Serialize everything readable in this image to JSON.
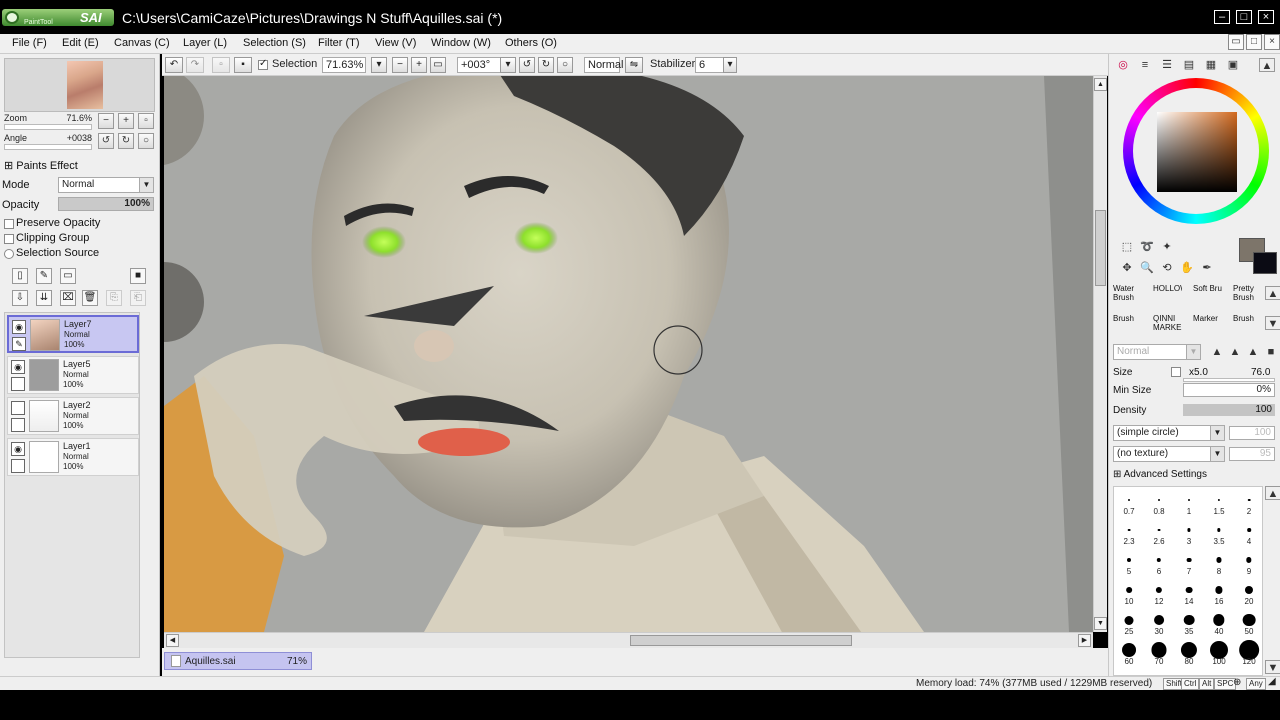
{
  "window": {
    "app_logo_small": "PaintTool",
    "app_logo_big": "SAI",
    "title": "C:\\Users\\CamiCaze\\Pictures\\Drawings N Stuff\\Aquilles.sai (*)"
  },
  "menu": [
    "File (F)",
    "Edit (E)",
    "Canvas (C)",
    "Layer (L)",
    "Selection (S)",
    "Filter (T)",
    "View (V)",
    "Window (W)",
    "Others (O)"
  ],
  "navigator": {
    "zoom_label": "Zoom",
    "zoom_value": "71.6%",
    "angle_label": "Angle",
    "angle_value": "+0038"
  },
  "layer_props": {
    "paints_effect": "Paints Effect",
    "mode_label": "Mode",
    "mode_value": "Normal",
    "opacity_label": "Opacity",
    "opacity_value": "100%",
    "preserve_opacity": "Preserve Opacity",
    "clipping_group": "Clipping Group",
    "selection_source": "Selection Source"
  },
  "layers": [
    {
      "name": "Layer7",
      "mode": "Normal",
      "opacity": "100%",
      "selected": true
    },
    {
      "name": "Layer5",
      "mode": "Normal",
      "opacity": "100%",
      "selected": false
    },
    {
      "name": "Layer2",
      "mode": "Normal",
      "opacity": "100%",
      "selected": false
    },
    {
      "name": "Layer1",
      "mode": "Normal",
      "opacity": "100%",
      "selected": false
    }
  ],
  "toolbar": {
    "selection_label": "Selection",
    "zoom": "71.63%",
    "rotation": "+003°",
    "blend": "Normal",
    "stabilizer_label": "Stabilizer",
    "stabilizer_value": "6"
  },
  "document_tab": {
    "name": "Aquilles.sai",
    "zoom": "71%"
  },
  "brushes": [
    {
      "label": "Water Brush"
    },
    {
      "label": "HOLLOW"
    },
    {
      "label": "Soft Bru"
    },
    {
      "label": "Pretty Brush"
    },
    {
      "label": "Brush"
    },
    {
      "label": "QINNI MARKER"
    },
    {
      "label": "Marker"
    },
    {
      "label": "Brush"
    }
  ],
  "tool_settings": {
    "blend_mode": "Normal",
    "size_label": "Size",
    "size_mult": "x5.0",
    "size_value": "76.0",
    "min_size_label": "Min Size",
    "min_size_value": "0%",
    "density_label": "Density",
    "density_value": "100",
    "shape": "(simple circle)",
    "shape_value": "100",
    "texture": "(no texture)",
    "texture_value": "95",
    "advanced": "Advanced Settings"
  },
  "brush_sizes": [
    "0.7",
    "0.8",
    "1",
    "1.5",
    "2",
    "2.3",
    "2.6",
    "3",
    "3.5",
    "4",
    "5",
    "6",
    "7",
    "8",
    "9",
    "10",
    "12",
    "14",
    "16",
    "20",
    "25",
    "30",
    "35",
    "40",
    "50",
    "60",
    "70",
    "80",
    "100",
    "120"
  ],
  "status": {
    "memory": "Memory load: 74% (377MB used / 1229MB reserved)",
    "keys": [
      "Shift",
      "Ctrl",
      "Alt",
      "SPC",
      "Any"
    ]
  },
  "colors": {
    "primary": "#7d756a",
    "secondary": "#0b0b14",
    "selection": "#c8c7f2",
    "canvas_bg": "#a8a9a6"
  }
}
